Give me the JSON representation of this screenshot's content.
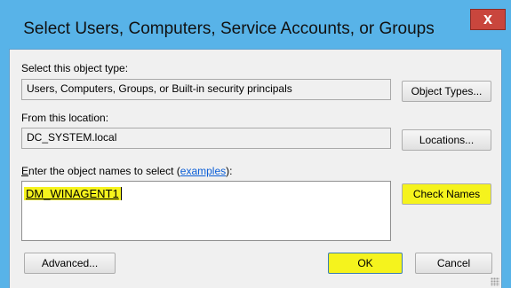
{
  "window": {
    "title": "Select Users, Computers, Service Accounts, or Groups",
    "close_label": "x"
  },
  "object_type": {
    "label": "Select this object type:",
    "value": "Users, Computers, Groups, or Built-in security principals",
    "button": "Object Types..."
  },
  "location": {
    "label": "From this location:",
    "value": "DC_SYSTEM.local",
    "button": "Locations..."
  },
  "names": {
    "label_prefix": "nter the object names to select (",
    "label_first_char": "E",
    "label_link": "examples",
    "label_suffix": "):",
    "value": "DM_WINAGENT1",
    "check_names_button": "Check Names"
  },
  "footer": {
    "advanced_button": "Advanced...",
    "ok_button": "OK",
    "cancel_button": "Cancel"
  },
  "colors": {
    "titlebar": "#58b3e8",
    "close_button": "#c9463d",
    "highlight": "#f5f31d",
    "dialog_bg": "#f0f0f0"
  }
}
